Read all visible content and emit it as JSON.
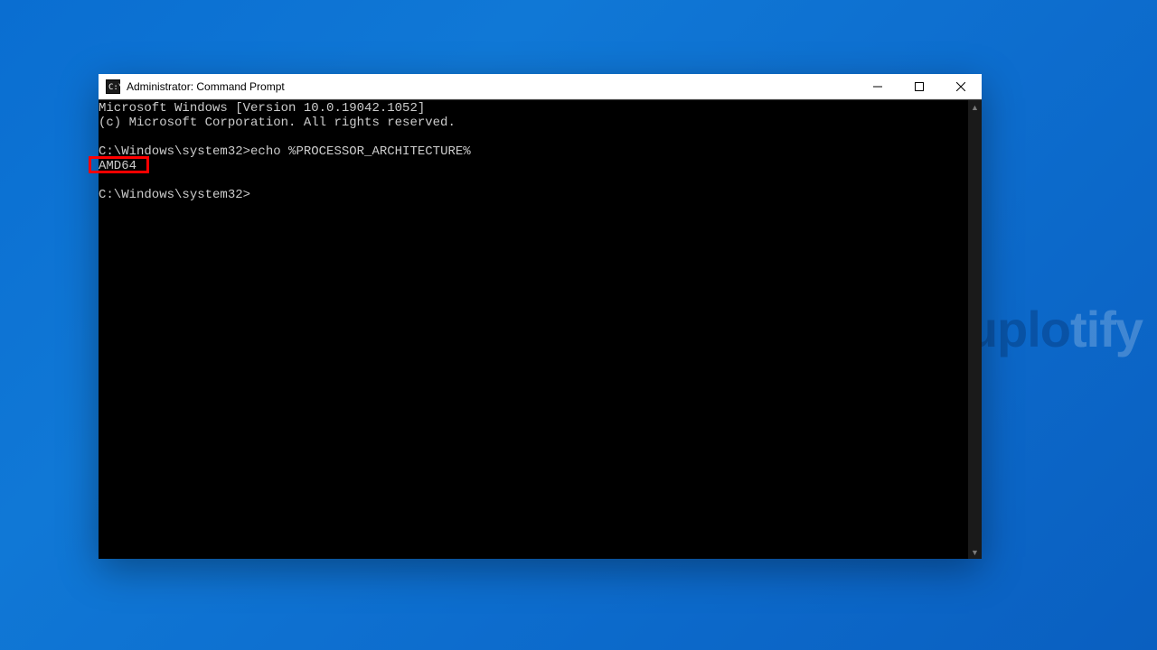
{
  "watermark": {
    "part1": "uplo",
    "part2": "tify"
  },
  "window": {
    "title": "Administrator: Command Prompt"
  },
  "terminal": {
    "line1": "Microsoft Windows [Version 10.0.19042.1052]",
    "line2": "(c) Microsoft Corporation. All rights reserved.",
    "prompt1_prefix": "C:\\Windows\\system32>",
    "prompt1_cmd": "echo %PROCESSOR_ARCHITECTURE%",
    "output1": "AMD64",
    "prompt2_prefix": "C:\\Windows\\system32>",
    "prompt2_cmd": ""
  }
}
